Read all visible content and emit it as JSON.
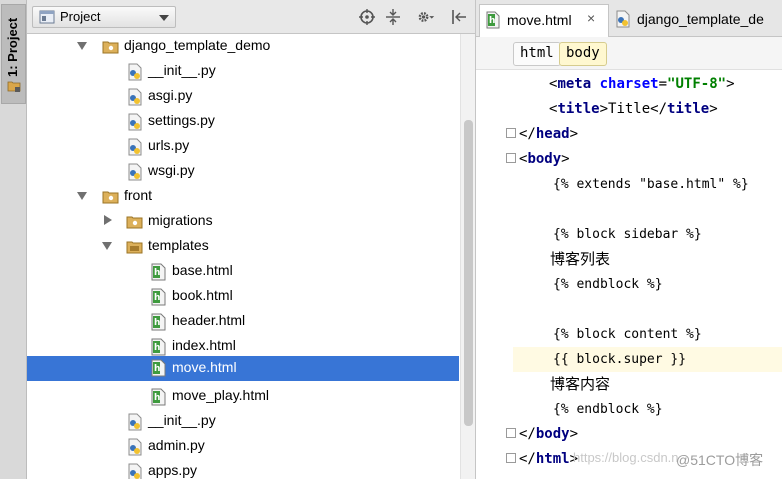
{
  "tool_window": {
    "label": "1: Project"
  },
  "project_panel": {
    "view_selector": "Project",
    "header_icons": [
      "crosshair-icon",
      "collapse-all-icon",
      "gear-icon",
      "pin-hide-icon"
    ]
  },
  "tree": [
    {
      "label": "django_template_demo",
      "kind": "folder",
      "expanded": true
    },
    {
      "label": "__init__.py",
      "kind": "py"
    },
    {
      "label": "asgi.py",
      "kind": "py"
    },
    {
      "label": "settings.py",
      "kind": "py"
    },
    {
      "label": "urls.py",
      "kind": "py"
    },
    {
      "label": "wsgi.py",
      "kind": "py"
    },
    {
      "label": "front",
      "kind": "folder",
      "expanded": true
    },
    {
      "label": "migrations",
      "kind": "folder",
      "expanded": false
    },
    {
      "label": "templates",
      "kind": "folder",
      "expanded": true
    },
    {
      "label": "base.html",
      "kind": "html"
    },
    {
      "label": "book.html",
      "kind": "html"
    },
    {
      "label": "header.html",
      "kind": "html"
    },
    {
      "label": "index.html",
      "kind": "html"
    },
    {
      "label": "move.html",
      "kind": "html",
      "selected": true
    },
    {
      "label": "move_play.html",
      "kind": "html"
    },
    {
      "label": "__init__.py",
      "kind": "py"
    },
    {
      "label": "admin.py",
      "kind": "py"
    },
    {
      "label": "apps.py",
      "kind": "py"
    }
  ],
  "editor": {
    "tabs": [
      {
        "label": "move.html",
        "active": true,
        "close": "×"
      },
      {
        "label": "django_template_de",
        "active": false
      }
    ],
    "breadcrumbs": [
      "html",
      "body"
    ],
    "code": {
      "l1_open": "<",
      "l1_tag": "meta",
      "l1_attr": "charset",
      "l1_eq": "=",
      "l1_str": "\"UTF-8\"",
      "l1_close": ">",
      "l2_open": "<",
      "l2_tag": "title",
      "l2_mid": ">Title</",
      "l2_tag2": "title",
      "l2_close": ">",
      "l3_open": "</",
      "l3_tag": "head",
      "l3_close": ">",
      "l4_open": "<",
      "l4_tag": "body",
      "l4_close": ">",
      "l5": "{% extends \"base.html\" %}",
      "l6": "",
      "l7": "{% block sidebar %}",
      "l8": "博客列表",
      "l9": "{% endblock %}",
      "l10": "",
      "l11": "{% block content %}",
      "l12": "{{ block.super }}",
      "l13": "博客内容",
      "l14": "{% endblock %}",
      "l15_open": "</",
      "l15_tag": "body",
      "l15_close": ">",
      "l16_open": "</",
      "l16_tag": "html",
      "l16_close": ">"
    }
  },
  "watermark": {
    "url": "https://blog.csdn.n",
    "brand": "@51CTO博客"
  }
}
